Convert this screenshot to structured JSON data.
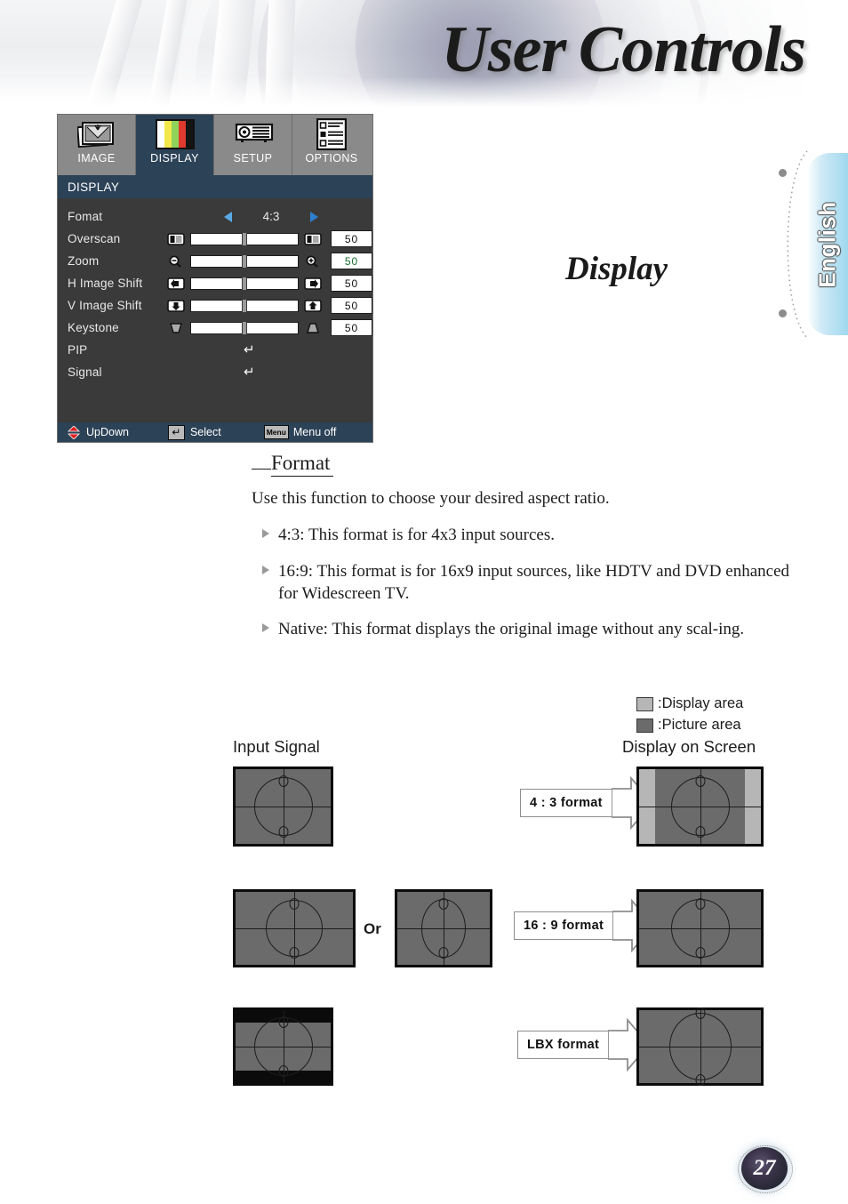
{
  "header": {
    "title_part1": "User",
    "title_part2": "Controls"
  },
  "language_tab": {
    "label": "English"
  },
  "section": {
    "title": "Display"
  },
  "osd": {
    "tabs": [
      {
        "label": "IMAGE",
        "icon": "image-icon",
        "active": false
      },
      {
        "label": "DISPLAY",
        "icon": "colorbars-icon",
        "active": true
      },
      {
        "label": "SETUP",
        "icon": "projector-icon",
        "active": false
      },
      {
        "label": "OPTIONS",
        "icon": "list-settings-icon",
        "active": false
      }
    ],
    "header_label": "DISPLAY",
    "rows": [
      {
        "label": "Fomat",
        "type": "selector",
        "value": "4:3"
      },
      {
        "label": "Overscan",
        "type": "slider",
        "value": "50",
        "value_color": "#111111",
        "left_icon": "overscan-left-icon",
        "right_icon": "overscan-right-icon"
      },
      {
        "label": "Zoom",
        "type": "slider",
        "value": "50",
        "value_color": "#136b2b",
        "left_icon": "zoom-out-icon",
        "right_icon": "zoom-in-icon"
      },
      {
        "label": "H Image Shift",
        "type": "slider",
        "value": "50",
        "value_color": "#111111",
        "left_icon": "shift-left-icon",
        "right_icon": "shift-right-icon"
      },
      {
        "label": "V Image Shift",
        "type": "slider",
        "value": "50",
        "value_color": "#111111",
        "left_icon": "shift-down-icon",
        "right_icon": "shift-up-icon"
      },
      {
        "label": "Keystone",
        "type": "slider",
        "value": "50",
        "value_color": "#111111",
        "left_icon": "keystone-down-icon",
        "right_icon": "keystone-up-icon"
      },
      {
        "label": "PIP",
        "type": "submenu",
        "value": "↵"
      },
      {
        "label": "Signal",
        "type": "submenu",
        "value": "↵"
      }
    ],
    "footer": {
      "updown_label": "UpDown",
      "select_label": "Select",
      "select_glyph": "↵",
      "menu_badge": "Menu",
      "menu_label": "Menu off"
    }
  },
  "body": {
    "heading": "Format",
    "lead": "Use this function to choose your desired aspect ratio.",
    "bullets": [
      "4:3: This format is for 4x3 input sources.",
      "16:9: This format is for 16x9 input sources, like HDTV and DVD enhanced for Widescreen TV.",
      "Native: This format displays the original image without any scal-ing."
    ]
  },
  "diagram": {
    "legend": [
      {
        "label": ":Display area",
        "color": "#b6b6b6"
      },
      {
        "label": ":Picture area",
        "color": "#6b6b6b"
      }
    ],
    "col_left_title": "Input Signal",
    "col_right_title": "Display on Screen",
    "or_label": "Or",
    "rows": [
      {
        "arrow_label": "4 : 3 format"
      },
      {
        "arrow_label": "16 : 9 format"
      },
      {
        "arrow_label": "LBX format"
      }
    ]
  },
  "page_number": "27",
  "colors": {
    "osd_accent": "#2c4257",
    "osd_body": "#3a3a3a",
    "osd_tabbar": "#8a8a8a",
    "lang_tab": "#9fd8ee",
    "picture_area": "#6b6b6b",
    "display_area": "#b6b6b6"
  }
}
